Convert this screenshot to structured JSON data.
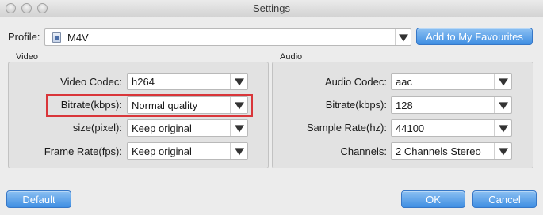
{
  "window": {
    "title": "Settings"
  },
  "profile": {
    "label": "Profile:",
    "value": "M4V",
    "icon": "video-file-icon"
  },
  "favourites_button": "Add to My Favourites",
  "video": {
    "group_label": "Video",
    "rows": [
      {
        "label": "Video Codec:",
        "value": "h264"
      },
      {
        "label": "Bitrate(kbps):",
        "value": "Normal quality"
      },
      {
        "label": "size(pixel):",
        "value": "Keep original"
      },
      {
        "label": "Frame Rate(fps):",
        "value": "Keep original"
      }
    ]
  },
  "audio": {
    "group_label": "Audio",
    "rows": [
      {
        "label": "Audio Codec:",
        "value": "aac"
      },
      {
        "label": "Bitrate(kbps):",
        "value": "128"
      },
      {
        "label": "Sample Rate(hz):",
        "value": "44100"
      },
      {
        "label": "Channels:",
        "value": "2 Channels Stereo"
      }
    ]
  },
  "buttons": {
    "default": "Default",
    "ok": "OK",
    "cancel": "Cancel"
  },
  "colors": {
    "accent_blue": "#3f8ee2",
    "highlight_red": "#d9363a"
  }
}
